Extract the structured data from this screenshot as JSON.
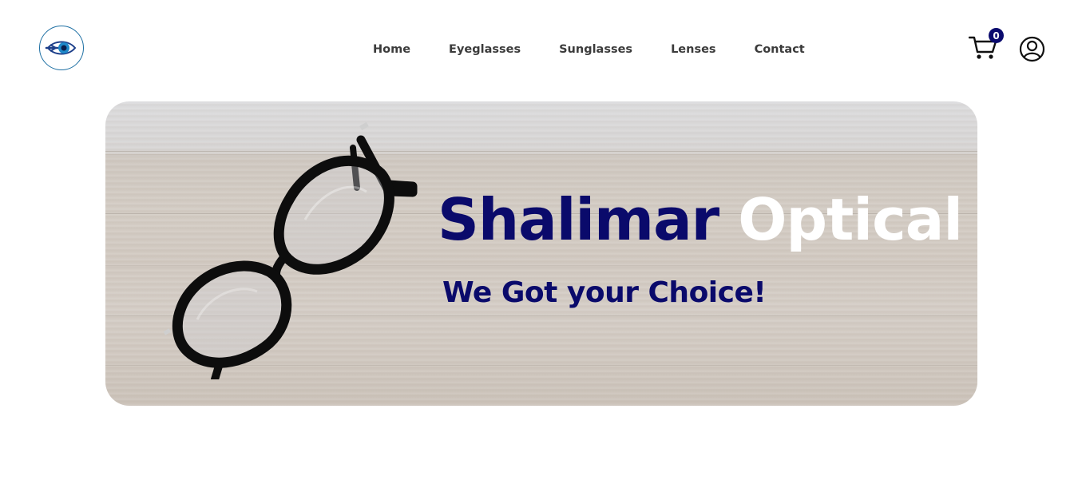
{
  "header": {
    "logo_icon": "eye-logo-icon",
    "nav": [
      {
        "label": "Home"
      },
      {
        "label": "Eyeglasses"
      },
      {
        "label": "Sunglasses"
      },
      {
        "label": "Lenses"
      },
      {
        "label": "Contact"
      }
    ],
    "cart_count": "0",
    "cart_icon": "cart-icon",
    "user_icon": "user-account-icon"
  },
  "hero": {
    "title_brand": "Shalimar",
    "title_accent": "Optical",
    "subtitle": "We Got your Choice!",
    "image_icon": "eyeglasses-photo"
  },
  "colors": {
    "brand_navy": "#0a0a6b",
    "nav_text": "#3b3b3b",
    "badge_bg": "#0b0b6e"
  }
}
